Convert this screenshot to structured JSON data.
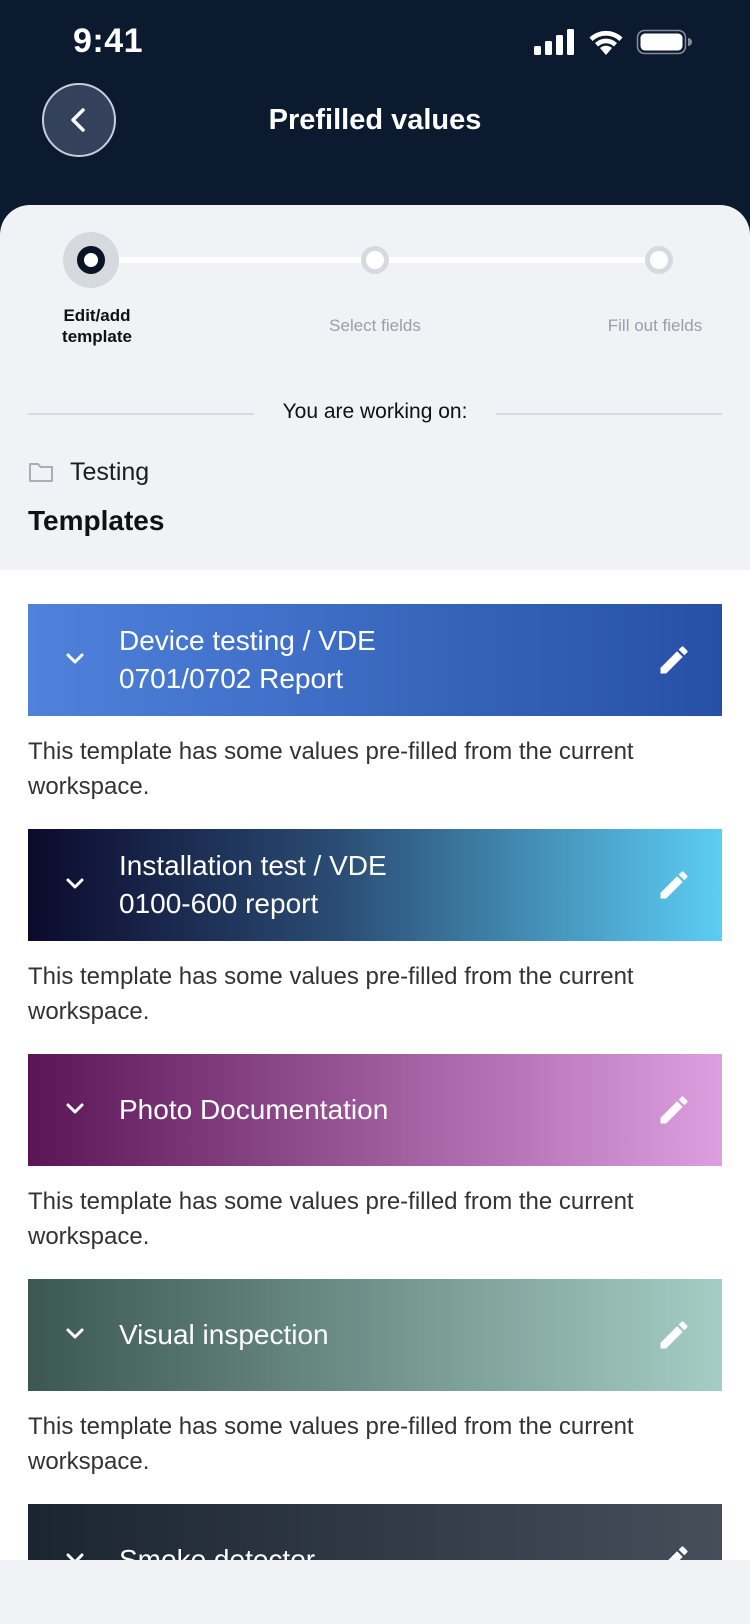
{
  "status_bar": {
    "time": "9:41"
  },
  "header": {
    "title": "Prefilled values"
  },
  "stepper": {
    "steps": [
      {
        "label": "Edit/add template",
        "active": true
      },
      {
        "label": "Select fields",
        "active": false
      },
      {
        "label": "Fill out fields",
        "active": false
      }
    ]
  },
  "working_on": {
    "label": "You are working on:",
    "workspace": "Testing"
  },
  "templates": {
    "title": "Templates",
    "items": [
      {
        "line1": "Device testing / VDE",
        "line2": "0701/0702 Report",
        "description": "This template has some values pre-filled from the current workspace.",
        "gradient": [
          "#4f82dc",
          "#2650a5"
        ]
      },
      {
        "line1": "Installation test / VDE",
        "line2": "0100-600 report",
        "description": "This template has some values pre-filled from the current workspace.",
        "gradient": [
          "#0b0a2c",
          "#5ccdf4"
        ]
      },
      {
        "line1": "Photo Documentation",
        "line2": "",
        "description": "This template has some values pre-filled from the current workspace.",
        "gradient": [
          "#5b1556",
          "#dd9fe0"
        ]
      },
      {
        "line1": "Visual inspection",
        "line2": "",
        "description": "This template has some values pre-filled from the current workspace.",
        "gradient": [
          "#3c5752",
          "#a5cdc4"
        ]
      },
      {
        "line1": "Smoke detector",
        "line2": "",
        "description": "",
        "gradient": [
          "#1b2431",
          "#464e5a"
        ]
      }
    ]
  }
}
